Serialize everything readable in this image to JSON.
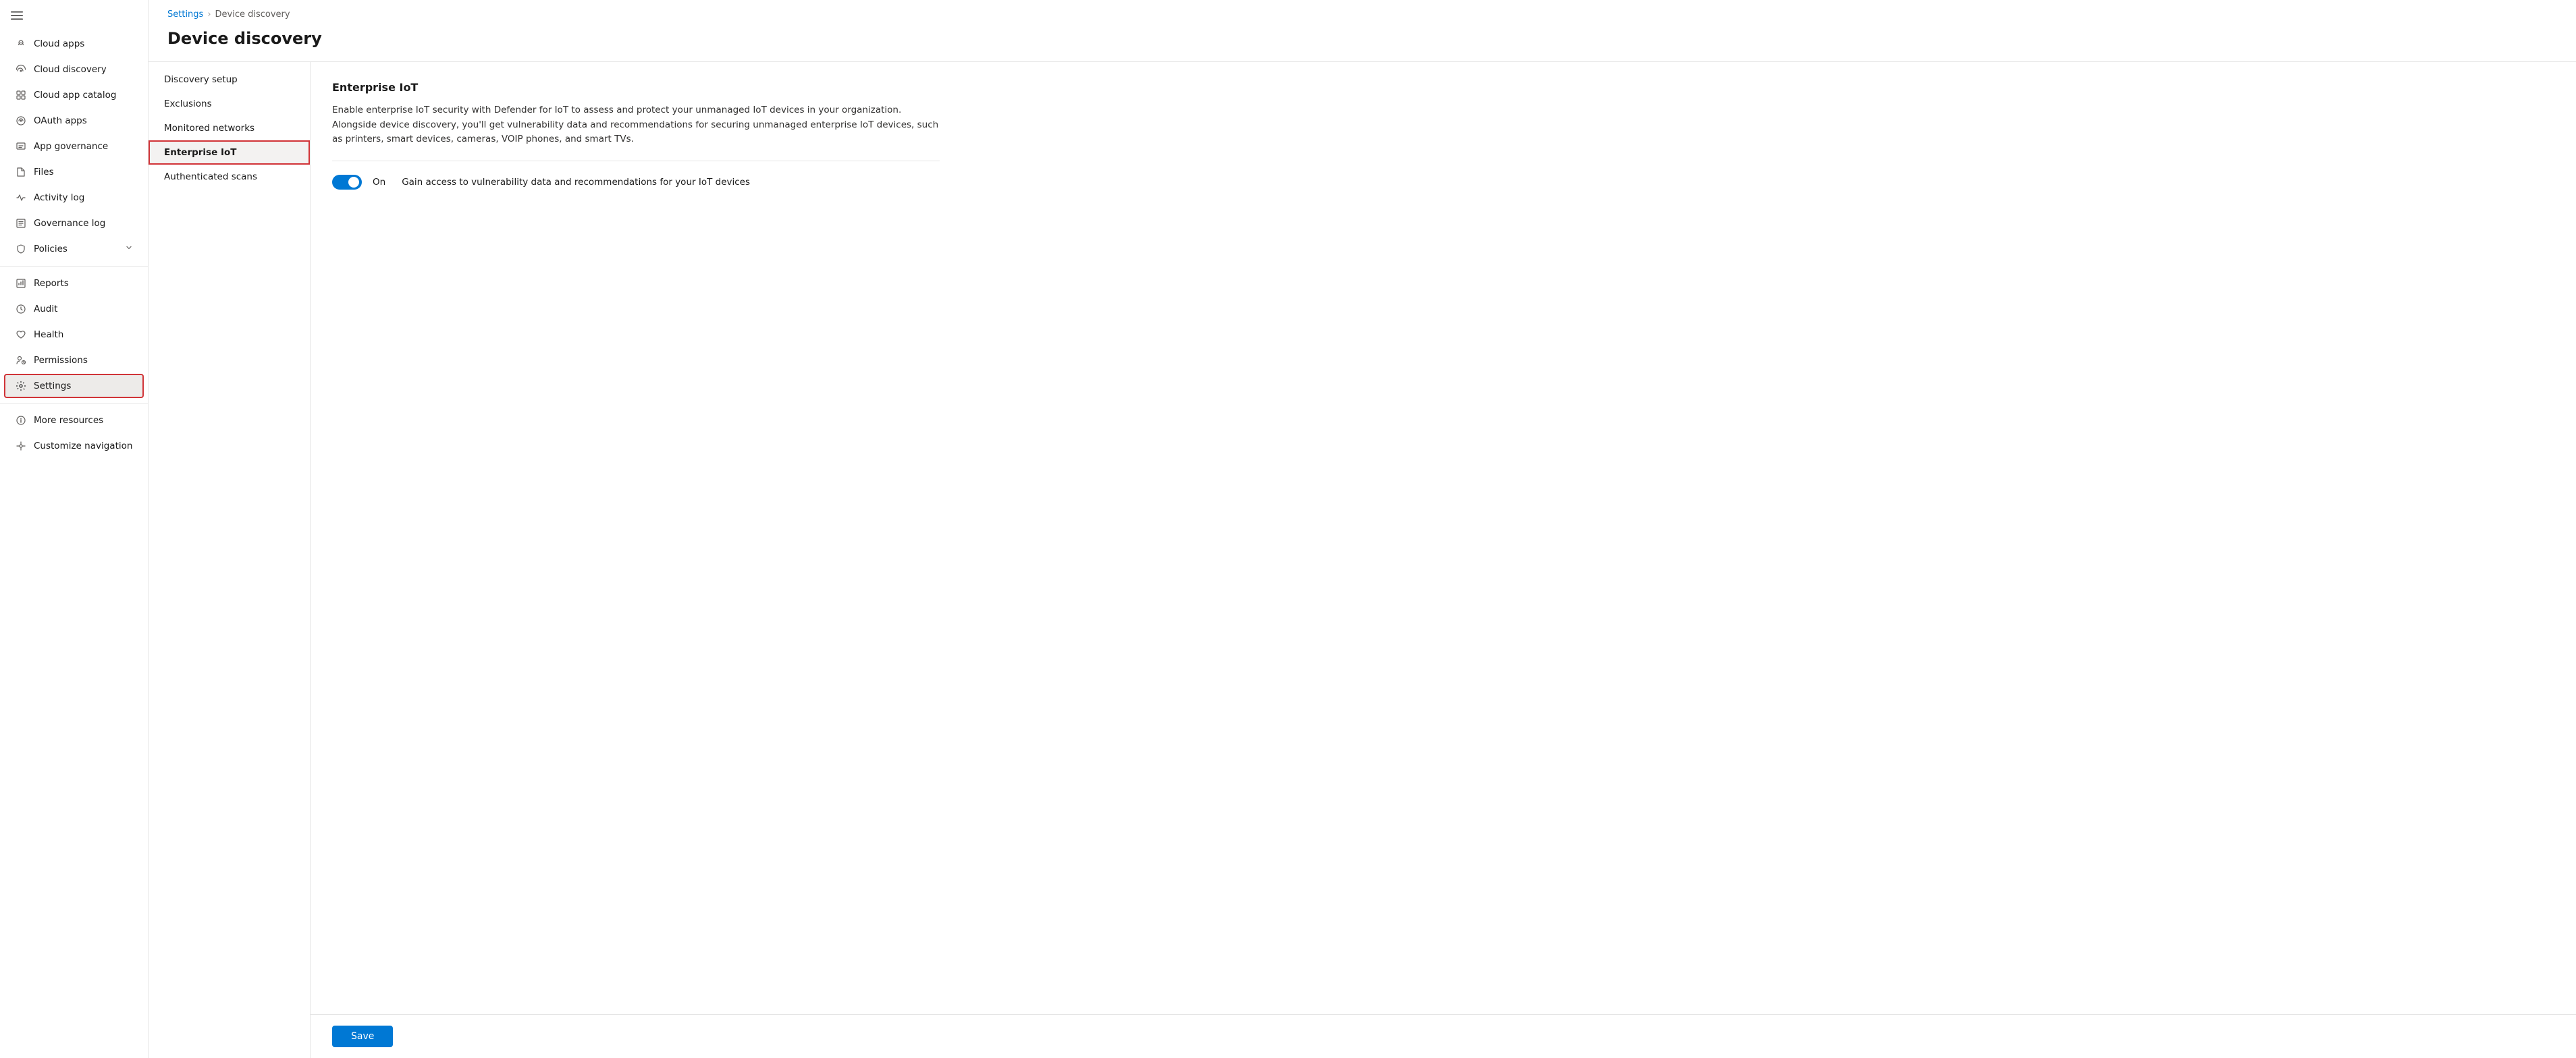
{
  "sidebar": {
    "hamburger_label": "Menu",
    "items": [
      {
        "id": "cloud-apps",
        "label": "Cloud apps",
        "icon": "cloud-apps-icon"
      },
      {
        "id": "cloud-discovery",
        "label": "Cloud discovery",
        "icon": "cloud-discovery-icon"
      },
      {
        "id": "cloud-app-catalog",
        "label": "Cloud app catalog",
        "icon": "catalog-icon"
      },
      {
        "id": "oauth-apps",
        "label": "OAuth apps",
        "icon": "oauth-icon"
      },
      {
        "id": "app-governance",
        "label": "App governance",
        "icon": "governance-icon"
      },
      {
        "id": "files",
        "label": "Files",
        "icon": "files-icon"
      },
      {
        "id": "activity-log",
        "label": "Activity log",
        "icon": "activity-icon"
      },
      {
        "id": "governance-log",
        "label": "Governance log",
        "icon": "governance-log-icon"
      },
      {
        "id": "policies",
        "label": "Policies",
        "icon": "policies-icon",
        "has_chevron": true
      },
      {
        "id": "reports",
        "label": "Reports",
        "icon": "reports-icon"
      },
      {
        "id": "audit",
        "label": "Audit",
        "icon": "audit-icon"
      },
      {
        "id": "health",
        "label": "Health",
        "icon": "health-icon"
      },
      {
        "id": "permissions",
        "label": "Permissions",
        "icon": "permissions-icon"
      },
      {
        "id": "settings",
        "label": "Settings",
        "icon": "settings-icon",
        "active": true
      },
      {
        "id": "more-resources",
        "label": "More resources",
        "icon": "more-icon"
      },
      {
        "id": "customize-navigation",
        "label": "Customize navigation",
        "icon": "customize-icon"
      }
    ]
  },
  "breadcrumb": {
    "items": [
      {
        "label": "Settings",
        "link": true
      },
      {
        "label": "Device discovery",
        "link": false
      }
    ]
  },
  "page": {
    "title": "Device discovery",
    "left_nav": [
      {
        "id": "discovery-setup",
        "label": "Discovery setup"
      },
      {
        "id": "exclusions",
        "label": "Exclusions"
      },
      {
        "id": "monitored-networks",
        "label": "Monitored networks"
      },
      {
        "id": "enterprise-iot",
        "label": "Enterprise IoT",
        "selected": true
      },
      {
        "id": "authenticated-scans",
        "label": "Authenticated scans"
      }
    ],
    "enterprise_iot": {
      "title": "Enterprise IoT",
      "description": "Enable enterprise IoT security with Defender for IoT to assess and protect your unmanaged IoT devices in your organization. Alongside device discovery, you'll get vulnerability data and recommendations for securing unmanaged enterprise IoT devices, such as printers, smart devices, cameras, VOIP phones, and smart TVs.",
      "toggle_state": "On",
      "toggle_desc": "Gain access to vulnerability data and recommendations for your IoT devices"
    },
    "save_label": "Save"
  }
}
